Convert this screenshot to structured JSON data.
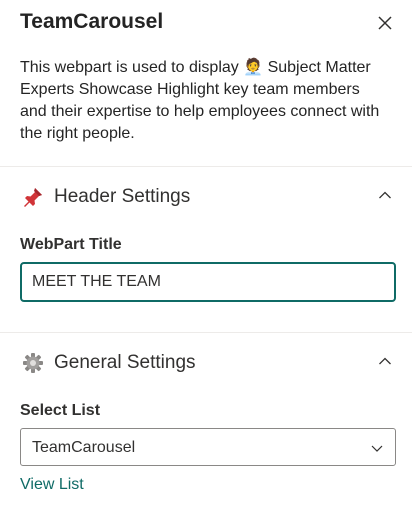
{
  "panel": {
    "title": "TeamCarousel",
    "description_before": "This webpart is used to display ",
    "description_emoji": "🧑‍💼",
    "description_after": " Subject Matter Experts Showcase Highlight key team members and their expertise to help employees connect with the right people."
  },
  "header_settings": {
    "icon": "pushpin-icon",
    "title": "Header Settings",
    "webpart_title_label": "WebPart Title",
    "webpart_title_value": "MEET THE TEAM"
  },
  "general_settings": {
    "icon": "gear-icon",
    "title": "General Settings",
    "select_list_label": "Select List",
    "select_list_value": "TeamCarousel",
    "view_list_link": "View List"
  },
  "colors": {
    "accent": "#0f6b66",
    "text": "#323130",
    "divider": "#edebe9"
  }
}
